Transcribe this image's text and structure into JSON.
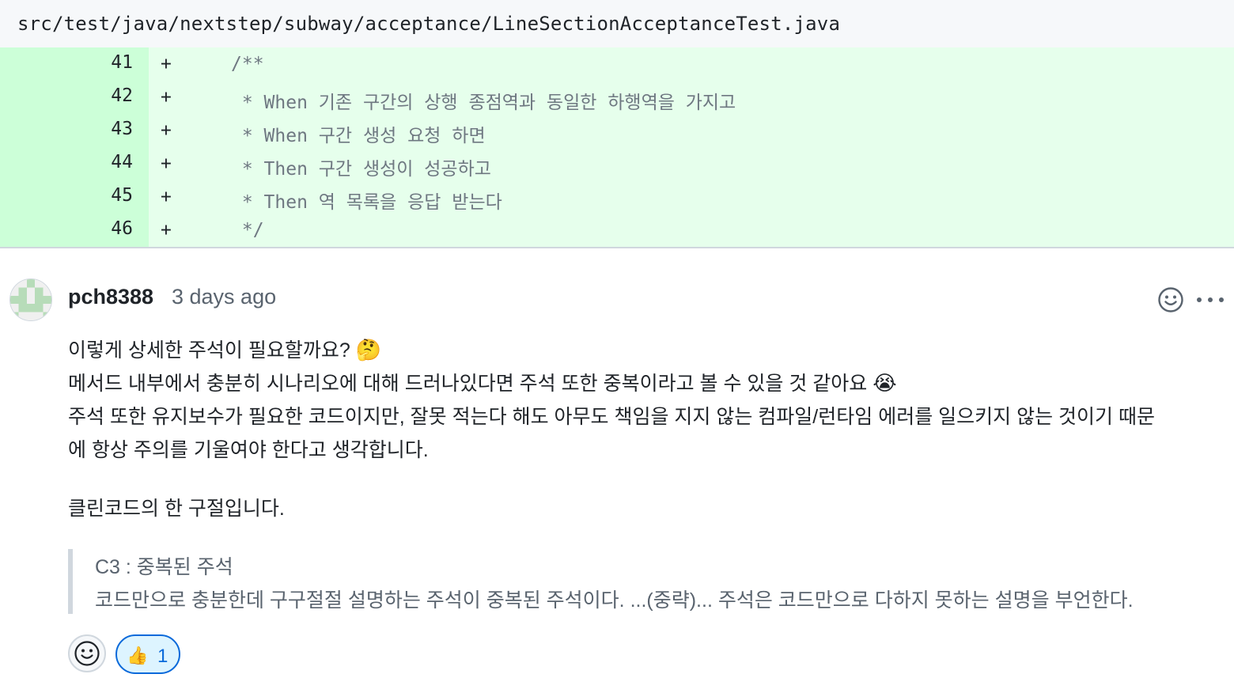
{
  "file": {
    "path": "src/test/java/nextstep/subway/acceptance/LineSectionAcceptanceTest.java"
  },
  "diff": {
    "lines": [
      {
        "num": "41",
        "marker": "+",
        "code": "/**"
      },
      {
        "num": "42",
        "marker": "+",
        "code": " * When 기존 구간의 상행 종점역과 동일한 하행역을 가지고"
      },
      {
        "num": "43",
        "marker": "+",
        "code": " * When 구간 생성 요청 하면"
      },
      {
        "num": "44",
        "marker": "+",
        "code": " * Then 구간 생성이 성공하고"
      },
      {
        "num": "45",
        "marker": "+",
        "code": " * Then 역 목록을 응답 받는다"
      },
      {
        "num": "46",
        "marker": "+",
        "code": " */"
      }
    ]
  },
  "comment": {
    "author": "pch8388",
    "time": "3 days ago",
    "paragraph1": {
      "line1": "이렇게 상세한 주석이 필요할까요?",
      "line1_emoji": "🤔",
      "line2": "메서드 내부에서 충분히 시나리오에 대해 드러나있다면 주석 또한 중복이라고 볼 수 있을 것 같아요",
      "line2_emoji": "😭",
      "line3": "주석 또한 유지보수가 필요한 코드이지만, 잘못 적는다 해도 아무도 책임을 지지 않는 컴파일/런타임 에러를 일으키지 않는 것이기 때문",
      "line4": "에 항상 주의를 기울여야 한다고 생각합니다."
    },
    "paragraph2": "클린코드의 한 구절입니다.",
    "quote": {
      "line1": "C3 : 중복된 주석",
      "line2": "코드만으로 충분한데 구구절절 설명하는 주석이 중복된 주석이다. ...(중략)... 주석은 코드만으로 다하지 못하는 설명을 부언한다."
    }
  },
  "reactions": {
    "thumbs_up_emoji": "👍",
    "thumbs_up_count": "1"
  },
  "icons": {
    "header_emoji": "smiley-icon",
    "header_more": "kebab-horizontal-icon",
    "add_reaction": "smiley-icon"
  },
  "colors": {
    "diff_add_bg": "#e6ffec",
    "diff_add_gutter": "#ccffd8",
    "reaction_active": "#0969da"
  }
}
